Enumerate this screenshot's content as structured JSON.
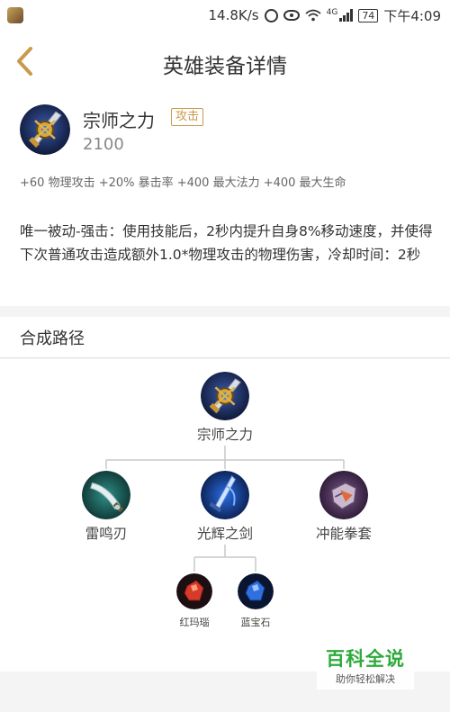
{
  "status_bar": {
    "speed": "14.8K/s",
    "network": "4G",
    "battery": "74",
    "time": "下午4:09"
  },
  "nav": {
    "title": "英雄装备详情"
  },
  "item": {
    "name": "宗师之力",
    "type": "攻击",
    "price": "2100",
    "stats": "+60 物理攻击 +20% 暴击率 +400 最大法力 +400 最大生命",
    "description": "唯一被动-强击：使用技能后，2秒内提升自身8%移动速度，并使得下次普通攻击造成额外1.0*物理攻击的物理伤害，冷却时间：2秒"
  },
  "recipe": {
    "title": "合成路径",
    "root": {
      "name": "宗师之力",
      "icon": "grandmaster-item-icon"
    },
    "components": [
      {
        "name": "雷鸣刃",
        "icon": "thunder-blade-icon"
      },
      {
        "name": "光辉之剑",
        "icon": "radiant-sword-icon",
        "children": [
          {
            "name": "红玛瑙",
            "icon": "red-agate-icon"
          },
          {
            "name": "蓝宝石",
            "icon": "sapphire-icon"
          }
        ]
      },
      {
        "name": "冲能拳套",
        "icon": "charged-gauntlet-icon"
      }
    ]
  },
  "watermark": {
    "title": "百科全说",
    "subtitle": "助你轻松解决"
  },
  "colors": {
    "accent_gold": "#c99a4b",
    "watermark_green": "#2eaa3c"
  }
}
